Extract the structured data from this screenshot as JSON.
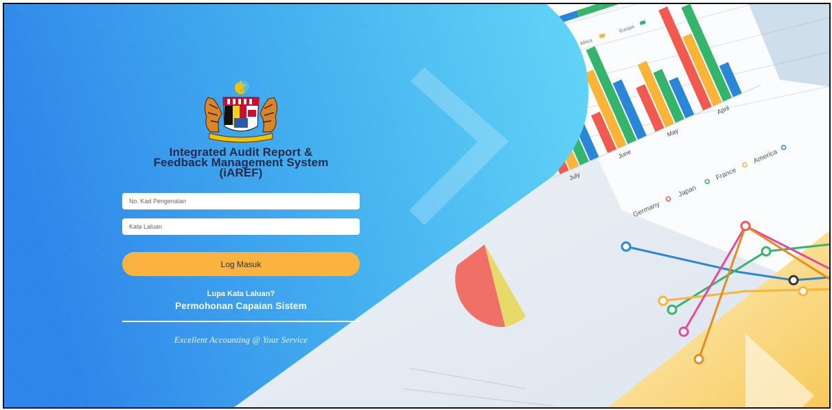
{
  "app": {
    "title_line1": "Integrated Audit Report &",
    "title_line2": "Feedback Management System",
    "title_line3": "(iAREF)",
    "logo": "malaysia-coat-of-arms"
  },
  "form": {
    "ic_placeholder": "No. Kad Pengenalan",
    "password_placeholder": "Kata Laluan",
    "login_label": "Log Masuk"
  },
  "links": {
    "forgot_password": "Lupa Kata Laluan?",
    "request_access": "Permohonan Capaian Sistem"
  },
  "tagline": "Excellent Accounting @ Your Service",
  "background": {
    "chart_labels": [
      "July",
      "June",
      "May",
      "April",
      "Germany",
      "Japan",
      "France",
      "America",
      "Africa",
      "Europe"
    ]
  },
  "colors": {
    "panel_light": "#5ed3f5",
    "panel_dark": "#2f86ea",
    "button": "#fbb340",
    "title": "#232b4d"
  }
}
